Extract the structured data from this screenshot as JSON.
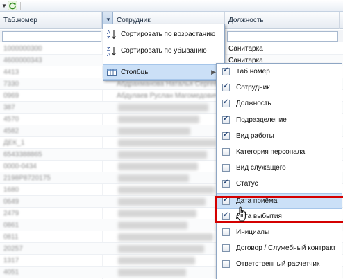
{
  "toolbar": {
    "dropdown_icon": "triangle-down-icon",
    "refresh_icon": "refresh-icon"
  },
  "columns": {
    "tab_number": "Таб.номер",
    "employee": "Сотрудник",
    "position": "Должность"
  },
  "rows": [
    {
      "tab": "1000000300",
      "employee": "",
      "position": "Санитарка"
    },
    {
      "tab": "4600000343",
      "employee": "",
      "position": "Санитарка"
    },
    {
      "tab": "4413",
      "employee": "",
      "position": ""
    },
    {
      "tab": "7330",
      "employee": "Абдрахманова Наталья Сергеевна",
      "position": ""
    },
    {
      "tab": "0969",
      "employee": "Абдулаев Руслан Магомедович",
      "position": ""
    },
    {
      "tab": "387",
      "employee": "",
      "position": ""
    },
    {
      "tab": "4570",
      "employee": "",
      "position": ""
    },
    {
      "tab": "4582",
      "employee": "",
      "position": ""
    },
    {
      "tab": "ДЕК_1",
      "employee": "",
      "position": ""
    },
    {
      "tab": "6543388865",
      "employee": "",
      "position": ""
    },
    {
      "tab": "0000-0434",
      "employee": "",
      "position": ""
    },
    {
      "tab": "2198Р8720175",
      "employee": "",
      "position": ""
    },
    {
      "tab": "1680",
      "employee": "",
      "position": ""
    },
    {
      "tab": "0649",
      "employee": "",
      "position": ""
    },
    {
      "tab": "2479",
      "employee": "",
      "position": ""
    },
    {
      "tab": "0861",
      "employee": "",
      "position": ""
    },
    {
      "tab": "0811",
      "employee": "",
      "position": ""
    },
    {
      "tab": "20257",
      "employee": "",
      "position": ""
    },
    {
      "tab": "1317",
      "employee": "",
      "position": ""
    },
    {
      "tab": "4051",
      "employee": "",
      "position": ""
    }
  ],
  "menu": {
    "sort_asc": "Сортировать по возрастанию",
    "sort_desc": "Сортировать по убыванию",
    "columns": "Столбцы"
  },
  "submenu": [
    {
      "label": "Таб.номер",
      "checked": true
    },
    {
      "label": "Сотрудник",
      "checked": true
    },
    {
      "label": "Должность",
      "checked": true
    },
    {
      "label": "Подразделение",
      "checked": true
    },
    {
      "label": "Вид работы",
      "checked": true
    },
    {
      "label": "Категория персонала",
      "checked": false
    },
    {
      "label": "Вид служащего",
      "checked": false
    },
    {
      "label": "Статус",
      "checked": true
    },
    {
      "label": "Дата приёма",
      "checked": true
    },
    {
      "label": "Дата выбытия",
      "checked": true
    },
    {
      "label": "Инициалы",
      "checked": false
    },
    {
      "label": "Договор / Служебный контракт",
      "checked": false
    },
    {
      "label": "Ответственный расчетчик",
      "checked": false
    }
  ],
  "colors": {
    "highlight": "#d40000",
    "menu_active": "#cbe0f7",
    "header_text": "#15263a"
  }
}
